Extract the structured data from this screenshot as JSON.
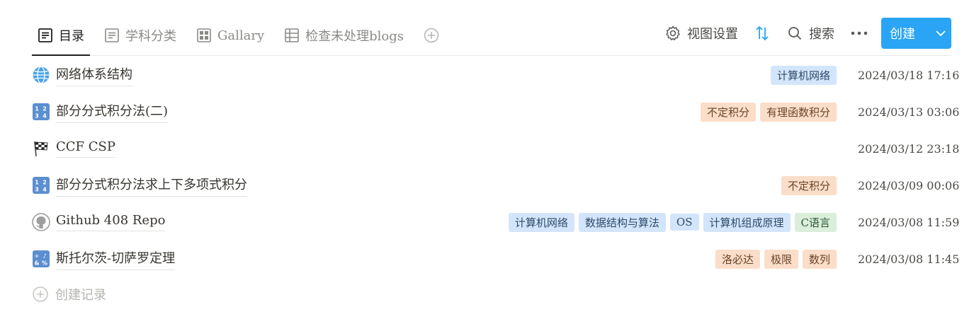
{
  "tabs": [
    {
      "label": "目录",
      "icon": "document-lines-icon",
      "active": true
    },
    {
      "label": "学科分类",
      "icon": "list-icon",
      "active": false
    },
    {
      "label": "Gallary",
      "icon": "gallery-grid-icon",
      "active": false
    },
    {
      "label": "检查未处理blogs",
      "icon": "table-icon",
      "active": false
    }
  ],
  "toolbar": {
    "view_settings_label": "视图设置",
    "search_label": "搜索",
    "create_label": "创建",
    "accent_color": "#2aa4f4"
  },
  "rows": [
    {
      "emoji": "globe",
      "title": "网络体系结构",
      "tags": [
        {
          "text": "计算机网络",
          "color": "blue"
        }
      ],
      "date": "2024/03/18 17:16"
    },
    {
      "emoji": "input-numbers",
      "title": "部分分式积分法(二)",
      "tags": [
        {
          "text": "不定积分",
          "color": "orange"
        },
        {
          "text": "有理函数积分",
          "color": "orange"
        }
      ],
      "date": "2024/03/13 03:06"
    },
    {
      "emoji": "checkered-flag",
      "title": "CCF CSP",
      "tags": [],
      "date": "2024/03/12 23:18"
    },
    {
      "emoji": "input-numbers",
      "title": "部分分式积分法求上下多项式积分",
      "tags": [
        {
          "text": "不定积分",
          "color": "orange"
        }
      ],
      "date": "2024/03/09 00:06"
    },
    {
      "emoji": "github",
      "title": "Github 408 Repo",
      "tags": [
        {
          "text": "计算机网络",
          "color": "blue"
        },
        {
          "text": "数据结构与算法",
          "color": "blue"
        },
        {
          "text": "OS",
          "color": "blue"
        },
        {
          "text": "计算机组成原理",
          "color": "blue"
        },
        {
          "text": "C语言",
          "color": "green"
        }
      ],
      "date": "2024/03/08 11:59"
    },
    {
      "emoji": "input-symbols",
      "title": "斯托尔茨-切萨罗定理",
      "tags": [
        {
          "text": "洛必达",
          "color": "orange"
        },
        {
          "text": "极限",
          "color": "orange"
        },
        {
          "text": "数列",
          "color": "orange"
        }
      ],
      "date": "2024/03/08 11:45"
    }
  ],
  "create_record_label": "创建记录"
}
